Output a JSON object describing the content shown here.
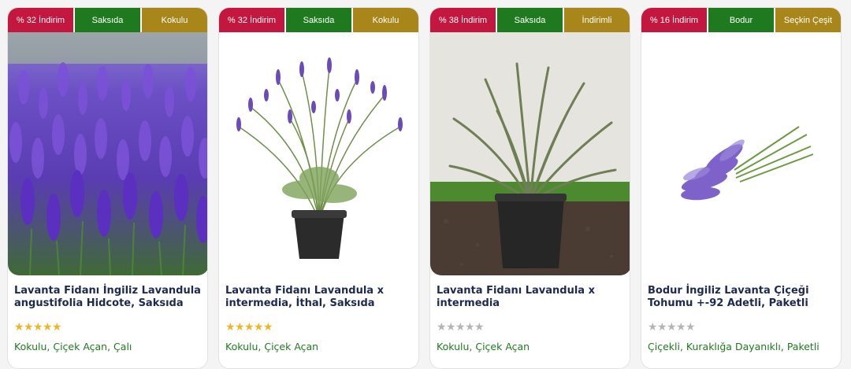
{
  "products": [
    {
      "badges": [
        "% 32 İndirim",
        "Saksıda",
        "Kokulu"
      ],
      "title": "Lavanta Fidanı İngiliz Lavandula angustifolia Hidcote, Saksıda",
      "rating": 5,
      "tags": "Kokulu, Çiçek Açan, Çalı"
    },
    {
      "badges": [
        "% 32 İndirim",
        "Saksıda",
        "Kokulu"
      ],
      "title": "Lavanta Fidanı Lavandula x intermedia, İthal, Saksıda",
      "rating": 5,
      "tags": "Kokulu, Çiçek Açan"
    },
    {
      "badges": [
        "% 38 İndirim",
        "Saksıda",
        "İndirimli"
      ],
      "title": "Lavanta Fidanı Lavandula x intermedia",
      "rating": 0,
      "tags": "Kokulu, Çiçek Açan"
    },
    {
      "badges": [
        "% 16 İndirim",
        "Bodur",
        "Seçkin Çeşit"
      ],
      "title": "Bodur İngiliz Lavanta Çiçeği Tohumu +-92 Adetli, Paketli",
      "rating": 0,
      "tags": "Çiçekli, Kuraklığa Dayanıklı, Paketli"
    }
  ],
  "colors": {
    "discount_badge": "#c4173f",
    "green_badge": "#1f7a1f",
    "gold_badge": "#a8861a",
    "star_filled": "#f0b429",
    "star_empty": "#b5b5b5",
    "tag_text": "#1f7a1f",
    "title_text": "#1d2a4d"
  }
}
